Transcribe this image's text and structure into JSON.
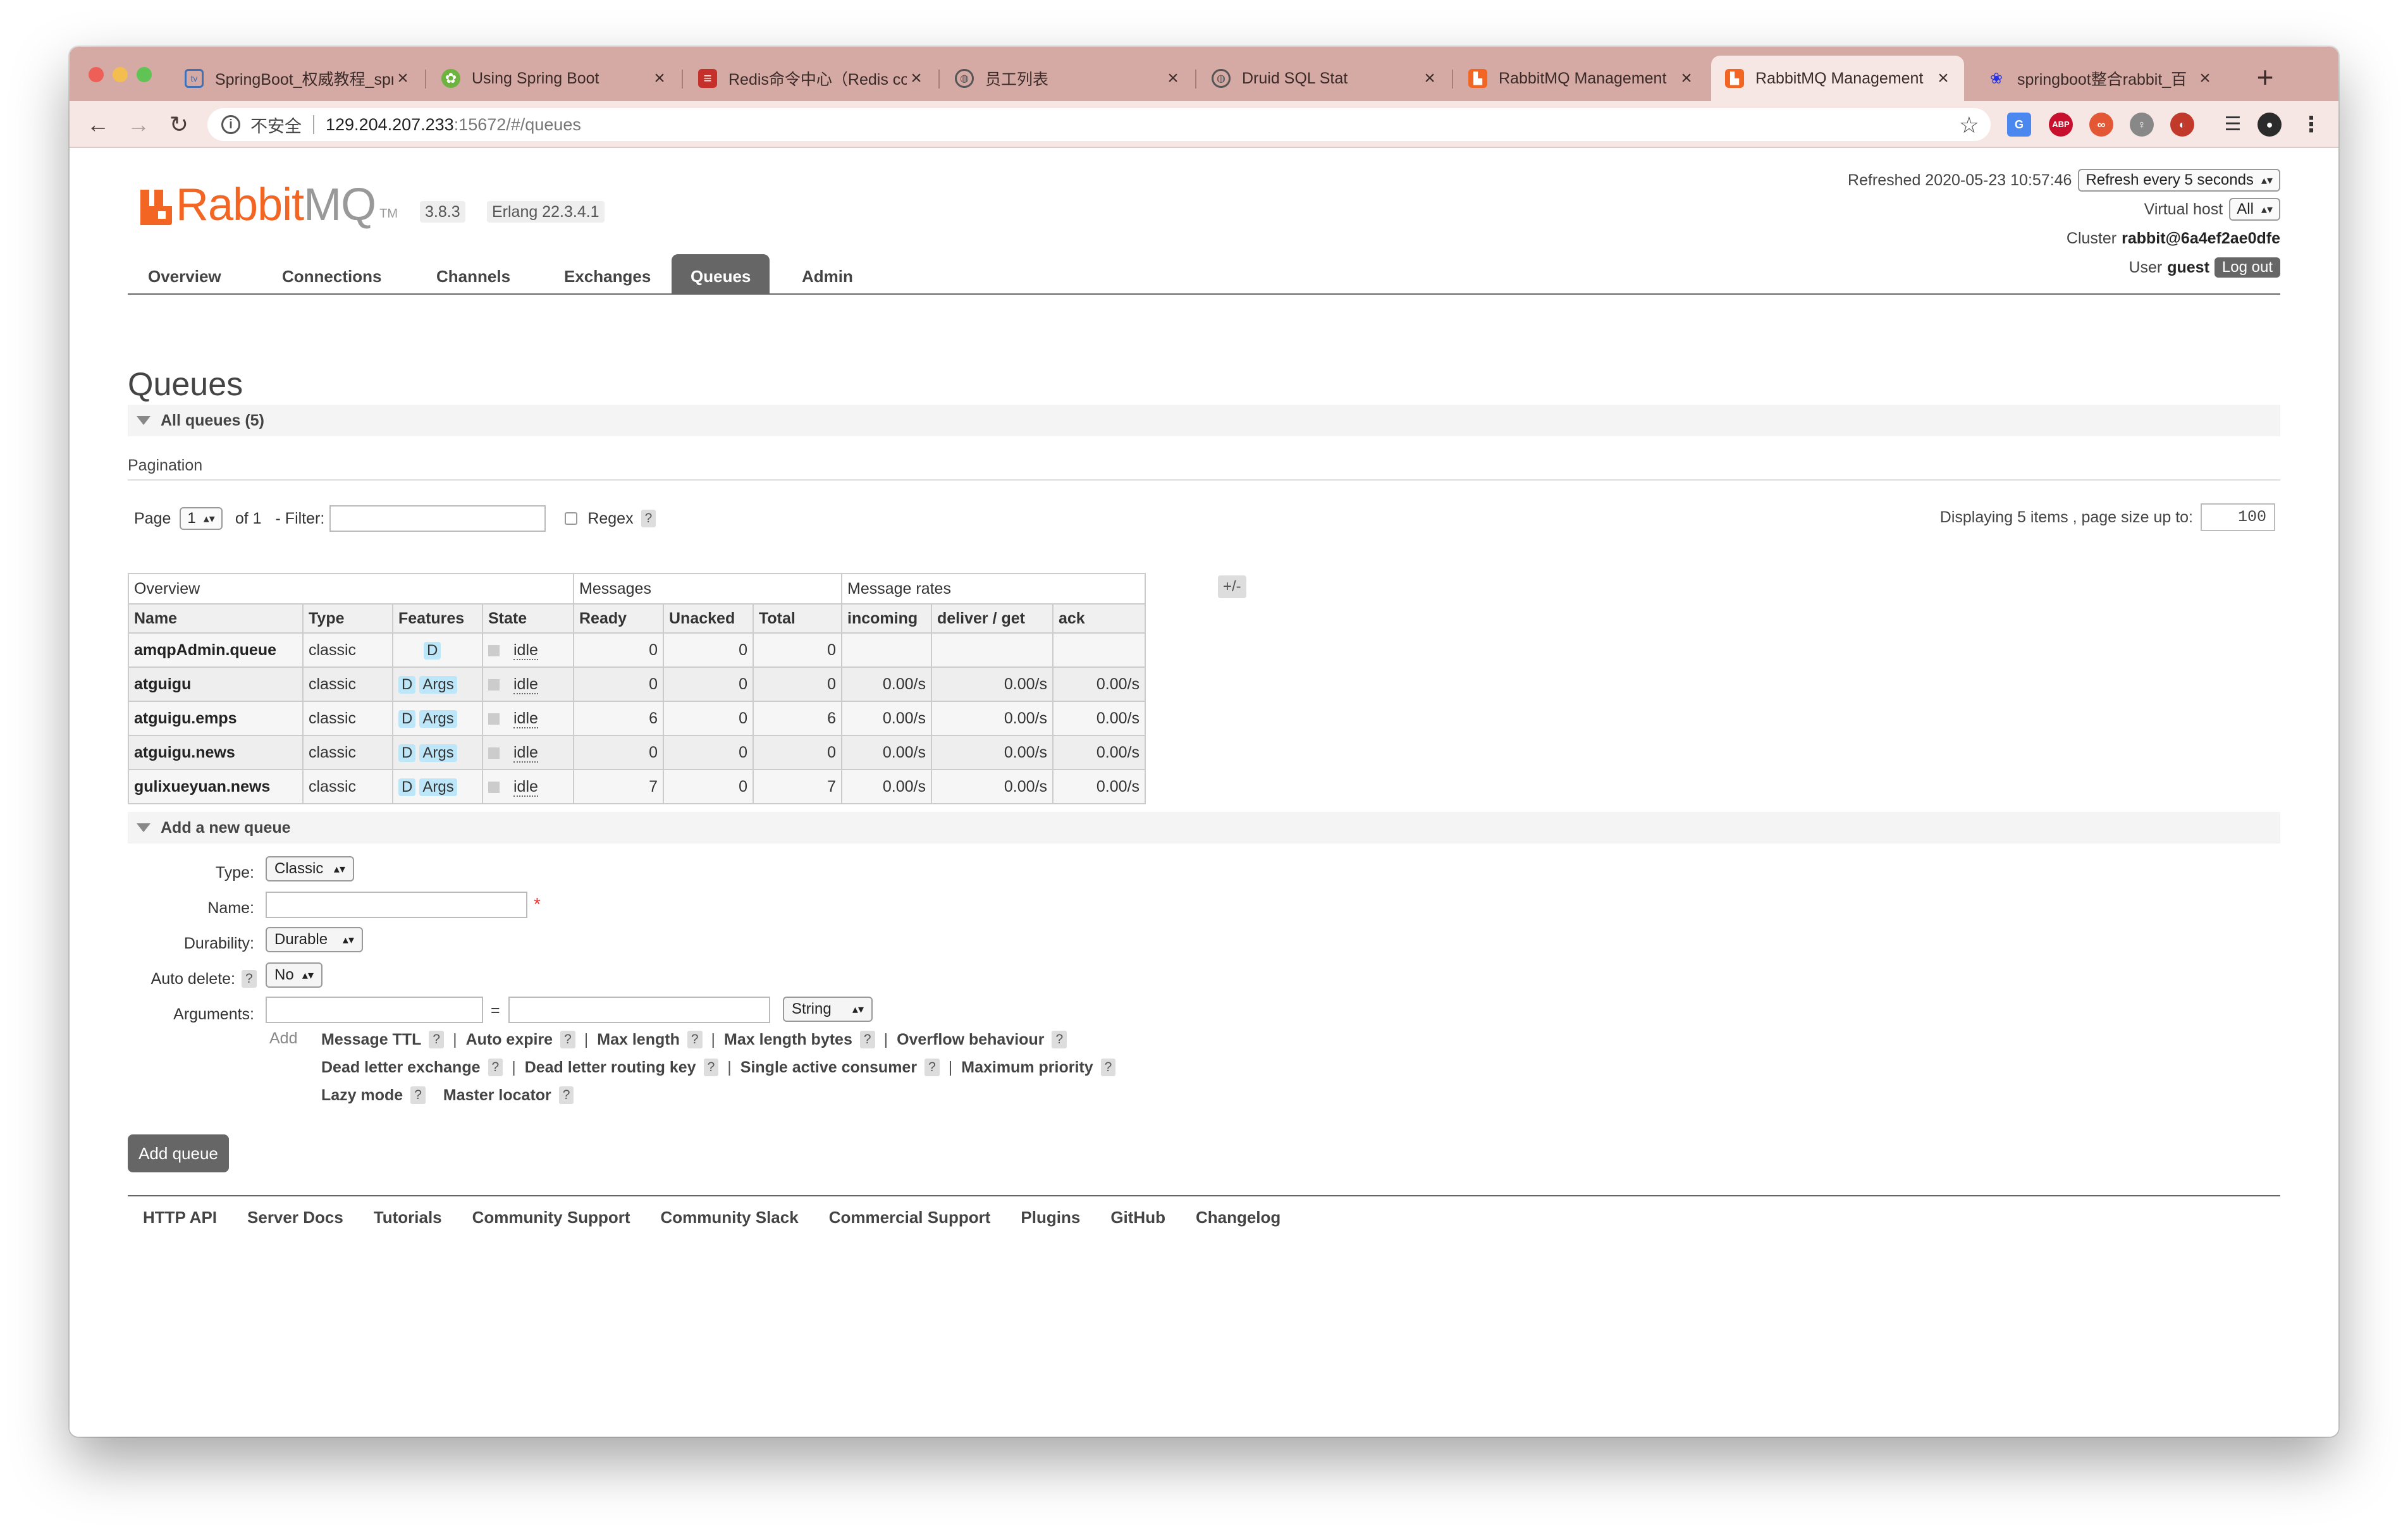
{
  "browser": {
    "tabs": [
      {
        "title": "SpringBoot_权威教程_spr",
        "favicon": "bilibili-icon"
      },
      {
        "title": "Using Spring Boot",
        "favicon": "spring-icon"
      },
      {
        "title": "Redis命令中心（Redis co",
        "favicon": "redis-icon"
      },
      {
        "title": "员工列表",
        "favicon": "globe-icon"
      },
      {
        "title": "Druid SQL Stat",
        "favicon": "globe-icon"
      },
      {
        "title": "RabbitMQ Management",
        "favicon": "rabbitmq-icon"
      },
      {
        "title": "RabbitMQ Management",
        "favicon": "rabbitmq-icon",
        "active": true
      },
      {
        "title": "springboot整合rabbit_百",
        "favicon": "baidu-icon"
      }
    ],
    "address": {
      "security_label": "不安全",
      "host": "129.204.207.233",
      "path": ":15672/#/queues"
    }
  },
  "header": {
    "logo_rabbit": "Rabbit",
    "logo_mq": "MQ",
    "logo_tm": "TM",
    "version": "3.8.3",
    "erlang": "Erlang 22.3.4.1",
    "refreshed_label": "Refreshed 2020-05-23 10:57:46",
    "refresh_option": "Refresh every 5 seconds",
    "vhost_label": "Virtual host",
    "vhost_value": "All",
    "cluster_label": "Cluster",
    "cluster_value": "rabbit@6a4ef2ae0dfe",
    "user_label": "User",
    "user_value": "guest",
    "logout_label": "Log out"
  },
  "nav": [
    "Overview",
    "Connections",
    "Channels",
    "Exchanges",
    "Queues",
    "Admin"
  ],
  "active_nav": "Queues",
  "page_title": "Queues",
  "all_queues_label": "All queues (5)",
  "pagination": {
    "section_label": "Pagination",
    "page_label": "Page",
    "page_value": "1",
    "of_label": "of 1",
    "filter_label": "- Filter:",
    "regex_label": "Regex",
    "help": "?",
    "displaying": "Displaying 5 items , page size up to:",
    "page_size": "100"
  },
  "table": {
    "groups": [
      "Overview",
      "Messages",
      "Message rates"
    ],
    "columns": [
      "Name",
      "Type",
      "Features",
      "State",
      "Ready",
      "Unacked",
      "Total",
      "incoming",
      "deliver / get",
      "ack"
    ],
    "toggle_label": "+/-",
    "rows": [
      {
        "name": "amqpAdmin.queue",
        "type": "classic",
        "features": [
          "D"
        ],
        "state": "idle",
        "ready": "0",
        "unacked": "0",
        "total": "0",
        "incoming": "",
        "deliver": "",
        "ack": ""
      },
      {
        "name": "atguigu",
        "type": "classic",
        "features": [
          "D",
          "Args"
        ],
        "state": "idle",
        "ready": "0",
        "unacked": "0",
        "total": "0",
        "incoming": "0.00/s",
        "deliver": "0.00/s",
        "ack": "0.00/s"
      },
      {
        "name": "atguigu.emps",
        "type": "classic",
        "features": [
          "D",
          "Args"
        ],
        "state": "idle",
        "ready": "6",
        "unacked": "0",
        "total": "6",
        "incoming": "0.00/s",
        "deliver": "0.00/s",
        "ack": "0.00/s"
      },
      {
        "name": "atguigu.news",
        "type": "classic",
        "features": [
          "D",
          "Args"
        ],
        "state": "idle",
        "ready": "0",
        "unacked": "0",
        "total": "0",
        "incoming": "0.00/s",
        "deliver": "0.00/s",
        "ack": "0.00/s"
      },
      {
        "name": "gulixueyuan.news",
        "type": "classic",
        "features": [
          "D",
          "Args"
        ],
        "state": "idle",
        "ready": "7",
        "unacked": "0",
        "total": "7",
        "incoming": "0.00/s",
        "deliver": "0.00/s",
        "ack": "0.00/s"
      }
    ]
  },
  "add_queue": {
    "section_label": "Add a new queue",
    "type_label": "Type:",
    "type_value": "Classic",
    "name_label": "Name:",
    "required_mark": "*",
    "durability_label": "Durability:",
    "durability_value": "Durable",
    "auto_delete_label": "Auto delete:",
    "auto_delete_value": "No",
    "arguments_label": "Arguments:",
    "equals": "=",
    "arg_type": "String",
    "add_label": "Add",
    "arg_links_row1": [
      "Message TTL",
      "Auto expire",
      "Max length",
      "Max length bytes",
      "Overflow behaviour"
    ],
    "arg_links_row2": [
      "Dead letter exchange",
      "Dead letter routing key",
      "Single active consumer",
      "Maximum priority"
    ],
    "arg_links_row3": [
      "Lazy mode",
      "Master locator"
    ],
    "submit_label": "Add queue"
  },
  "footer": [
    "HTTP API",
    "Server Docs",
    "Tutorials",
    "Community Support",
    "Community Slack",
    "Commercial Support",
    "Plugins",
    "GitHub",
    "Changelog"
  ],
  "colors": {
    "brand_orange": "#f26522",
    "tab_strip": "#d5a9a4",
    "active_nav": "#666666",
    "feature_badge": "#bde6f8"
  }
}
